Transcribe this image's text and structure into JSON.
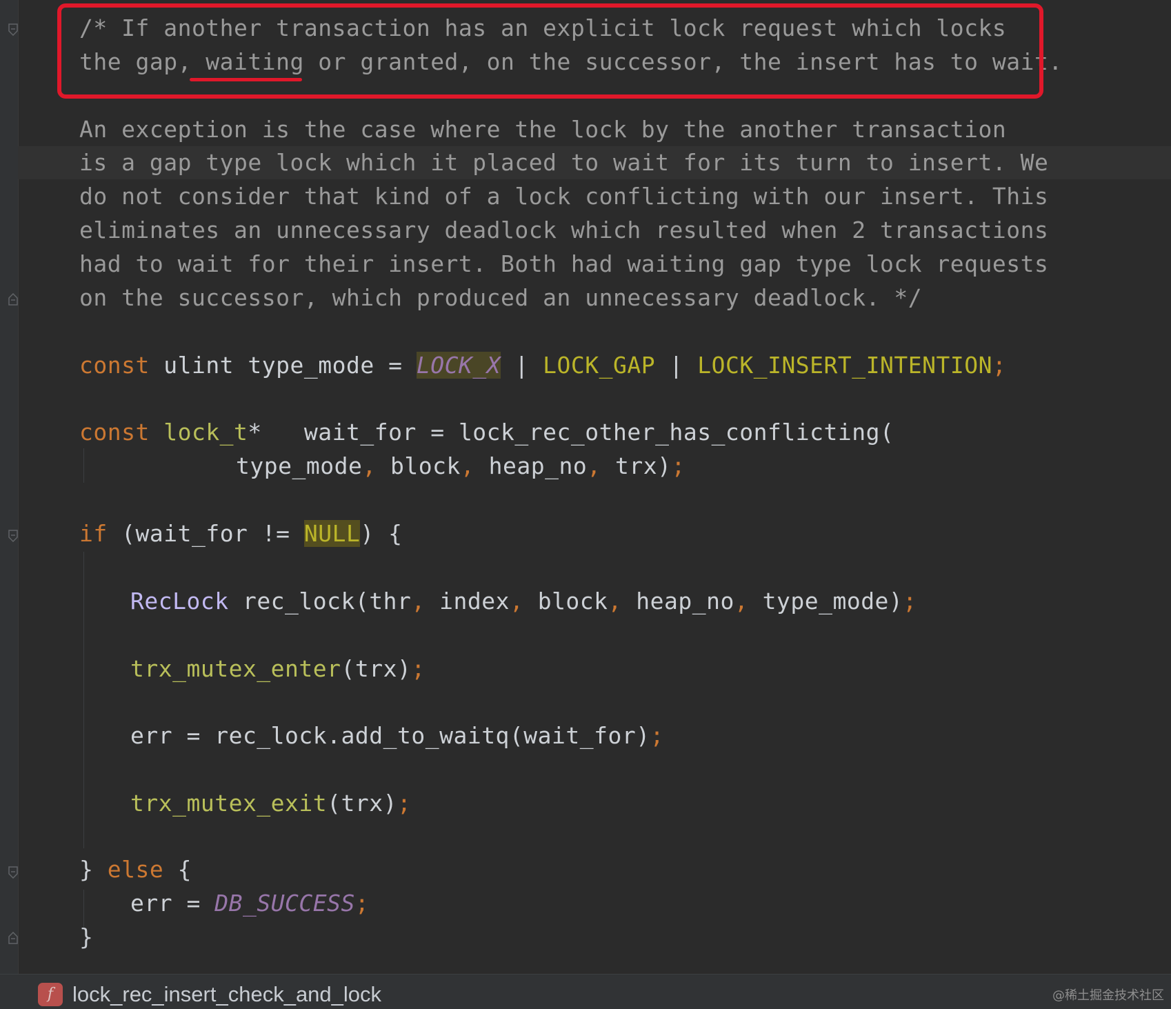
{
  "code": {
    "comment_lines": [
      "/* If another transaction has an explicit lock request which locks",
      "the gap, waiting or granted, on the successor, the insert has to wait.",
      "An exception is the case where the lock by the another transaction",
      "is a gap type lock which it placed to wait for its turn to insert. We",
      "do not consider that kind of a lock conflicting with our insert. This",
      "eliminates an unnecessary deadlock which resulted when 2 transactions",
      "had to wait for their insert. Both had waiting gap type lock requests",
      "on the successor, which produced an unnecessary deadlock. */"
    ],
    "line_type_mode": {
      "kw": "const",
      "rest": " ulint type_mode = ",
      "m1": "LOCK_X",
      "sep1": " | ",
      "m2": "LOCK_GAP",
      "sep2": " | ",
      "m3": "LOCK_INSERT_INTENTION",
      "end": ";"
    },
    "line_wait_for": {
      "kw": "const",
      "type": " lock_t",
      "star": "*",
      "rest": "   wait_for = lock_rec_other_has_conflicting("
    },
    "line_args": {
      "a1": "type_mode",
      "c1": ",",
      "a2": " block",
      "c2": ",",
      "a3": " heap_no",
      "c3": ",",
      "a4": " trx)",
      "end": ";"
    },
    "line_if": {
      "kw": "if",
      "open": " (wait_for != ",
      "null": "NULL",
      "close": ") {"
    },
    "line_reclock": {
      "cls": "RecLock",
      "p0": " rec_lock(thr",
      "c1": ",",
      "p1": " index",
      "c2": ",",
      "p2": " block",
      "c3": ",",
      "p3": " heap_no",
      "c4": ",",
      "p4": " type_mode)",
      "end": ";"
    },
    "line_enter": {
      "fn": "trx_mutex_enter",
      "args": "(trx)",
      "end": ";"
    },
    "line_err": {
      "text": "err = rec_lock.add_to_waitq(wait_for)",
      "end": ";"
    },
    "line_exit": {
      "fn": "trx_mutex_exit",
      "args": "(trx)",
      "end": ";"
    },
    "line_else": {
      "brace": "} ",
      "kw": "else",
      "open": " {"
    },
    "line_success": {
      "lhs": "err = ",
      "val": "DB_SUCCESS",
      "end": ";"
    },
    "line_close": "}"
  },
  "status_bar": {
    "badge": "f",
    "function_name": "lock_rec_insert_check_and_lock",
    "watermark": "@稀土掘金技术社区"
  }
}
